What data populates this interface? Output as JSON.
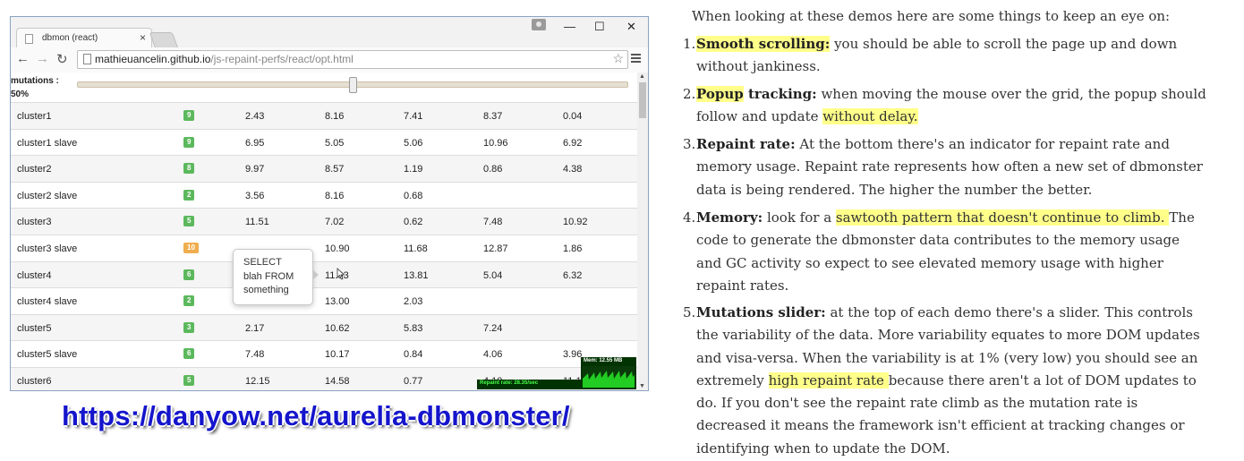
{
  "browser": {
    "tab_title": "dbmon (react)",
    "tab_close": "×",
    "window_buttons": {
      "minimize": "—",
      "maximize": "☐",
      "close": "✕"
    },
    "nav": {
      "back": "←",
      "forward": "→",
      "reload": "↻"
    },
    "url_host": "mathieuancelin.github.io",
    "url_path": "/js-repaint-perfs/react/opt.html",
    "star": "☆"
  },
  "app": {
    "mutations_label": "mutations :",
    "mutations_value": "50%",
    "slider_value": 0.5,
    "rows": [
      {
        "name": "cluster1",
        "count": "9",
        "badge_color": "#5cb85c",
        "values": [
          "2.43",
          "8.16",
          "7.41",
          "8.37",
          "0.04"
        ]
      },
      {
        "name": "cluster1 slave",
        "count": "9",
        "badge_color": "#5cb85c",
        "values": [
          "6.95",
          "5.05",
          "5.06",
          "10.96",
          "6.92"
        ]
      },
      {
        "name": "cluster2",
        "count": "8",
        "badge_color": "#5cb85c",
        "values": [
          "9.97",
          "8.57",
          "1.19",
          "0.86",
          "4.38"
        ]
      },
      {
        "name": "cluster2 slave",
        "count": "2",
        "badge_color": "#5cb85c",
        "values": [
          "3.56",
          "8.16",
          "0.68",
          "",
          ""
        ]
      },
      {
        "name": "cluster3",
        "count": "5",
        "badge_color": "#5cb85c",
        "values": [
          "11.51",
          "7.02",
          "0.62",
          "7.48",
          "10.92"
        ]
      },
      {
        "name": "cluster3 slave",
        "count": "10",
        "badge_color": "#f0ad4e",
        "values": [
          "",
          "10.90",
          "11.68",
          "12.87",
          "1.86"
        ]
      },
      {
        "name": "cluster4",
        "count": "6",
        "badge_color": "#5cb85c",
        "values": [
          "",
          "11.93",
          "13.81",
          "5.04",
          "6.32"
        ]
      },
      {
        "name": "cluster4 slave",
        "count": "2",
        "badge_color": "#5cb85c",
        "values": [
          "8.64",
          "13.00",
          "2.03",
          "",
          ""
        ]
      },
      {
        "name": "cluster5",
        "count": "3",
        "badge_color": "#5cb85c",
        "values": [
          "2.17",
          "10.62",
          "5.83",
          "7.24",
          ""
        ]
      },
      {
        "name": "cluster5 slave",
        "count": "6",
        "badge_color": "#5cb85c",
        "values": [
          "7.48",
          "10.17",
          "0.84",
          "4.06",
          "3.96"
        ]
      },
      {
        "name": "cluster6",
        "count": "5",
        "badge_color": "#5cb85c",
        "values": [
          "12.15",
          "14.58",
          "0.77",
          "4.10",
          "11.1"
        ]
      }
    ],
    "popover_lines": [
      "SELECT",
      "blah FROM",
      "something"
    ],
    "memory_label": "Mem: 12.55 MB",
    "repaint_label": "Repaint rate: 28.35/sec"
  },
  "link_text": "https://danyow.net/aurelia-dbmonster/",
  "article": {
    "intro": "When looking at these demos here are some things to keep an eye on:",
    "items": [
      {
        "num": "1.",
        "segments": [
          {
            "t": "Smooth scrolling:",
            "b": true,
            "h": true
          },
          {
            "t": " you should be able to scroll the page up and down without jankiness."
          }
        ]
      },
      {
        "num": "2.",
        "segments": [
          {
            "t": "Popup",
            "b": true,
            "h": true
          },
          {
            "t": " tracking:",
            "b": true
          },
          {
            "t": " when moving the mouse over the grid, the popup should follow and update "
          },
          {
            "t": "without delay.",
            "h": true
          }
        ]
      },
      {
        "num": "3.",
        "segments": [
          {
            "t": "Repaint rate:",
            "b": true
          },
          {
            "t": " At the bottom there's an indicator for repaint rate and memory usage. Repaint rate represents how often a new set of dbmonster data is being rendered. The higher the number the better."
          }
        ]
      },
      {
        "num": "4.",
        "segments": [
          {
            "t": "Memory:",
            "b": true
          },
          {
            "t": " look for a "
          },
          {
            "t": "sawtooth pattern that doesn't continue to climb. ",
            "h": true
          },
          {
            "t": "The code to generate the dbmonster data contributes to the memory usage and GC activity so expect to see elevated memory usage with higher repaint rates."
          }
        ]
      },
      {
        "num": "5.",
        "segments": [
          {
            "t": "Mutations slider:",
            "b": true
          },
          {
            "t": " at the top of each demo there's a slider. This controls the variability of the data. More variability equates to more DOM updates and visa-versa. When the variability is at 1% (very low) you should see an extremely "
          },
          {
            "t": "high repaint rate ",
            "h": true
          },
          {
            "t": "because there aren't a lot of DOM updates to do. If you don't see the repaint rate climb as the mutation rate is decreased it means the framework isn't efficient at tracking changes or identifying when to update the DOM."
          }
        ]
      }
    ]
  }
}
